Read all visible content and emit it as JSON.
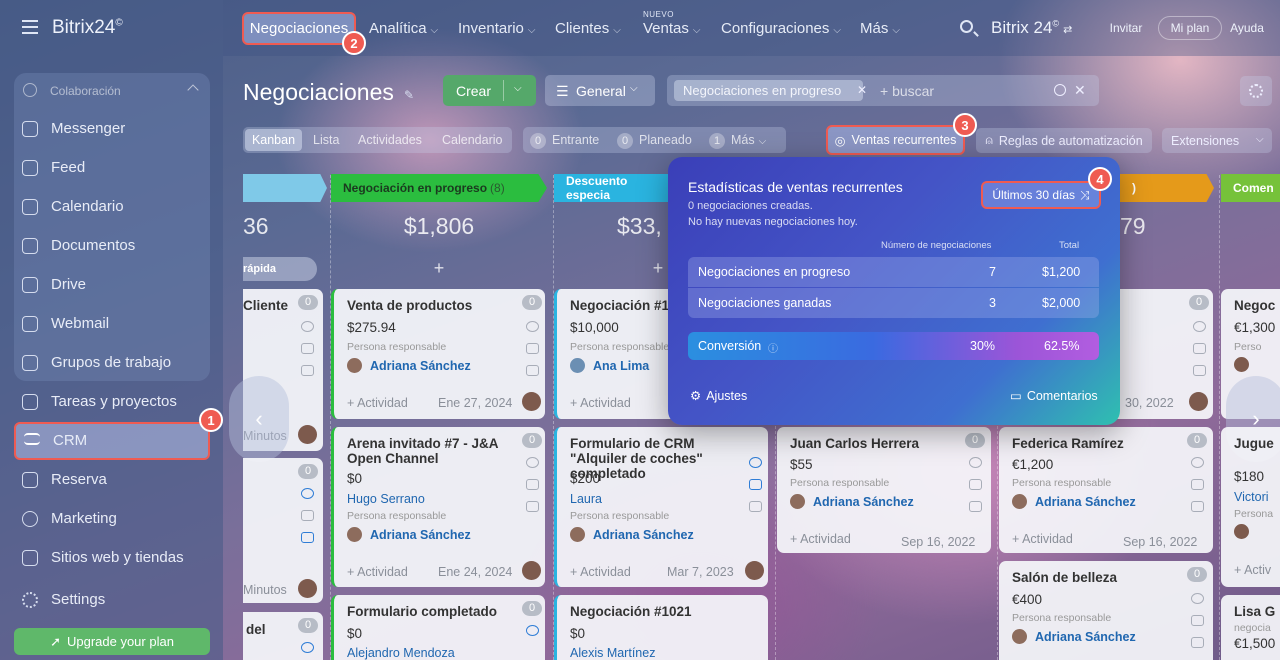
{
  "app": {
    "logo": "Bitrix24",
    "logo_mark": "©",
    "logo_top": "Bitrix 24"
  },
  "sidebar": {
    "group": "Colaboración",
    "items": [
      {
        "label": "Messenger",
        "icon": "chat-icon"
      },
      {
        "label": "Feed",
        "icon": "feed-icon"
      },
      {
        "label": "Calendario",
        "icon": "calendar-icon"
      },
      {
        "label": "Documentos",
        "icon": "document-icon"
      },
      {
        "label": "Drive",
        "icon": "drive-icon"
      },
      {
        "label": "Webmail",
        "icon": "mail-icon"
      },
      {
        "label": "Grupos de trabajo",
        "icon": "group-icon"
      },
      {
        "label": "Tareas y proyectos",
        "icon": "tasks-icon"
      },
      {
        "label": "CRM",
        "icon": "crm-funnel-icon"
      },
      {
        "label": "Reserva",
        "icon": "booking-icon"
      },
      {
        "label": "Marketing",
        "icon": "marketing-icon"
      },
      {
        "label": "Sitios web y tiendas",
        "icon": "cart-icon"
      },
      {
        "label": "Settings",
        "icon": "gear-icon"
      }
    ],
    "upgrade": "Upgrade your plan"
  },
  "topnav": {
    "items": [
      "Negociaciones",
      "Analítica",
      "Inventario",
      "Clientes",
      "Ventas",
      "Configuraciones",
      "Más"
    ],
    "nuevo": "NUEVO",
    "invite": "Invitar",
    "plan": "Mi plan",
    "help": "Ayuda"
  },
  "toolbar": {
    "title": "Negociaciones",
    "create": "Crear",
    "filter_preset": "General",
    "chip": "Negociaciones en progreso",
    "search_placeholder": "+ buscar"
  },
  "views": {
    "items": [
      "Kanban",
      "Lista",
      "Actividades",
      "Calendario"
    ]
  },
  "counters": [
    {
      "n": "0",
      "label": "Entrante"
    },
    {
      "n": "0",
      "label": "Planeado"
    },
    {
      "n": "1",
      "label": "Más"
    }
  ],
  "actions": {
    "recurring": "Ventas recurrentes",
    "rules": "Reglas de automatización",
    "extensions": "Extensiones"
  },
  "annotations": [
    "1",
    "2",
    "3",
    "4"
  ],
  "columns": [
    {
      "title": "",
      "sum": "36",
      "quick": "rápida",
      "color": "#7fc9e8"
    },
    {
      "title": "Negociación en progreso",
      "count": "(8)",
      "sum": "$1,806",
      "color": "#2bbd3f"
    },
    {
      "title": "Descuento especia",
      "sum": "$33,",
      "color": "#2ab4e0"
    },
    {
      "title": ")",
      "sum": "79",
      "color": "#e59a1a"
    },
    {
      "title": "Comen",
      "sum": "",
      "color": "#76c23a"
    }
  ],
  "cards": {
    "c0a": {
      "title": "Cliente",
      "zero": "0",
      "foot": "Minutos"
    },
    "c0b": {
      "zero": "0",
      "foot": "Minutos"
    },
    "c0c": {
      "title": "del",
      "zero": "0"
    },
    "c1a": {
      "title": "Venta de productos",
      "amount": "$275.94",
      "resp": "Persona responsable",
      "person": "Adriana Sánchez",
      "act": "+ Actividad",
      "date": "Ene 27, 2024",
      "zero": "0"
    },
    "c1b": {
      "title": "Arena invitado #7 - J&A Open Channel",
      "amount": "$0",
      "client": "Hugo Serrano",
      "resp": "Persona responsable",
      "person": "Adriana Sánchez",
      "act": "+ Actividad",
      "date": "Ene 24, 2024",
      "zero": "0"
    },
    "c1c": {
      "title": "Formulario completado",
      "amount": "$0",
      "client": "Alejandro Mendoza",
      "zero": "0"
    },
    "c2a": {
      "title": "Negociación #101",
      "amount": "$10,000",
      "resp": "Persona responsable",
      "person": "Ana Lima",
      "act": "+ Actividad"
    },
    "c2b": {
      "title": "Formulario de CRM \"Alquiler de coches\" completado",
      "amount": "$200",
      "client": "Laura",
      "resp": "Persona responsable",
      "person": "Adriana Sánchez",
      "act": "+ Actividad",
      "date": "Mar 7, 2023"
    },
    "c2c": {
      "title": "Negociación #1021",
      "amount": "$0",
      "client": "Alexis Martínez"
    },
    "c3a": {
      "date": "30, 2022",
      "zero": "0"
    },
    "c3b": {
      "title": "Juan Carlos Herrera",
      "amount": "$55",
      "resp": "Persona responsable",
      "person": "Adriana Sánchez",
      "act": "+ Actividad",
      "date": "Sep 16, 2022",
      "zero": "0"
    },
    "c4a": {
      "title": "Federica Ramírez",
      "amount": "€1,200",
      "resp": "Persona responsable",
      "person": "Adriana Sánchez",
      "act": "+ Actividad",
      "date": "Sep 16, 2022",
      "zero": "0"
    },
    "c4b": {
      "title": "Salón de belleza",
      "amount": "€400",
      "resp": "Persona responsable",
      "person": "Adriana Sánchez",
      "zero": "0"
    },
    "c5a": {
      "title": "Negoc",
      "amount": "€1,300",
      "resp": "Perso"
    },
    "c5b": {
      "title": "Jugue",
      "amount": "$180",
      "client": "Victori",
      "resp": "Persona",
      "act": "+ Activ"
    },
    "c5c": {
      "title": "Lisa G",
      "resp": "negocia",
      "amount": "€1,500"
    }
  },
  "popup": {
    "title": "Estadísticas de ventas recurrentes",
    "sub1": "0 negociaciones creadas.",
    "sub2": "No hay nuevas negociaciones hoy.",
    "period": "Últimos 30 días",
    "col_count": "Número de negociaciones",
    "col_total": "Total",
    "rows": [
      {
        "label": "Negociaciones en progreso",
        "count": "7",
        "total": "$1,200"
      },
      {
        "label": "Negociaciones ganadas",
        "count": "3",
        "total": "$2,000"
      }
    ],
    "conversion": {
      "label": "Conversión",
      "count": "30%",
      "total": "62.5%"
    },
    "settings": "Ajustes",
    "comments": "Comentarios"
  }
}
